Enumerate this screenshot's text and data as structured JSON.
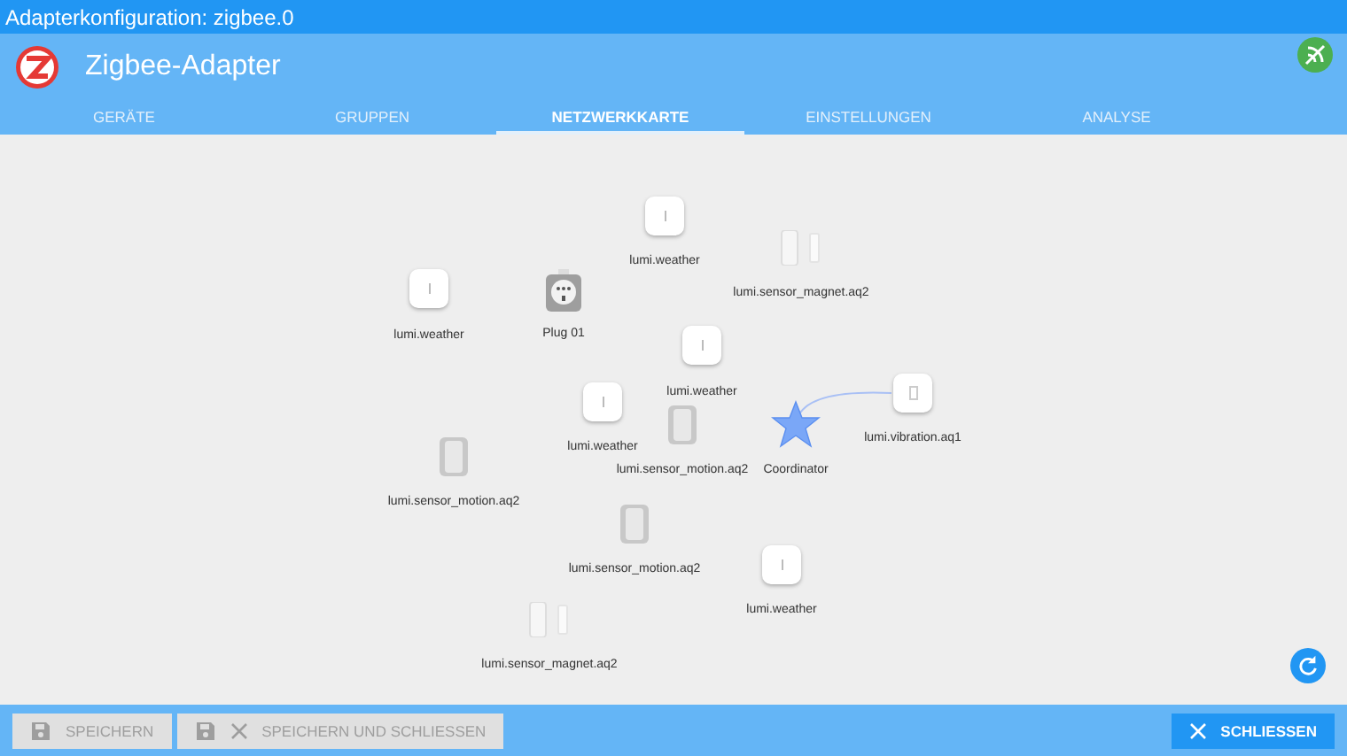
{
  "window": {
    "title": "Adapterkonfiguration: zigbee.0"
  },
  "header": {
    "title": "Zigbee-Adapter"
  },
  "tabs": [
    {
      "label": "GERÄTE",
      "selected": false
    },
    {
      "label": "GRUPPEN",
      "selected": false
    },
    {
      "label": "NETZWERKKARTE",
      "selected": true
    },
    {
      "label": "EINSTELLUNGEN",
      "selected": false
    },
    {
      "label": "ANALYSE",
      "selected": false
    }
  ],
  "map": {
    "nodes": [
      {
        "kind": "weather",
        "label": "lumi.weather"
      },
      {
        "kind": "magnet",
        "label": "lumi.sensor_magnet.aq2"
      },
      {
        "kind": "weather",
        "label": "lumi.weather"
      },
      {
        "kind": "plug",
        "label": "Plug 01"
      },
      {
        "kind": "weather",
        "label": "lumi.weather"
      },
      {
        "kind": "weather",
        "label": "lumi.weather"
      },
      {
        "kind": "motion",
        "label": "lumi.sensor_motion.aq2"
      },
      {
        "kind": "coordinator",
        "label": "Coordinator"
      },
      {
        "kind": "vibration",
        "label": "lumi.vibration.aq1"
      },
      {
        "kind": "motion",
        "label": "lumi.sensor_motion.aq2"
      },
      {
        "kind": "motion",
        "label": "lumi.sensor_motion.aq2"
      },
      {
        "kind": "weather",
        "label": "lumi.weather"
      },
      {
        "kind": "magnet",
        "label": "lumi.sensor_magnet.aq2"
      }
    ]
  },
  "footer": {
    "buttons": [
      {
        "kind": "save",
        "label": "SPEICHERN",
        "disabled": true
      },
      {
        "kind": "save-close",
        "label": "SPEICHERN UND SCHLIESSEN",
        "disabled": true
      },
      {
        "kind": "close",
        "label": "SCHLIESSEN",
        "disabled": false
      }
    ]
  }
}
